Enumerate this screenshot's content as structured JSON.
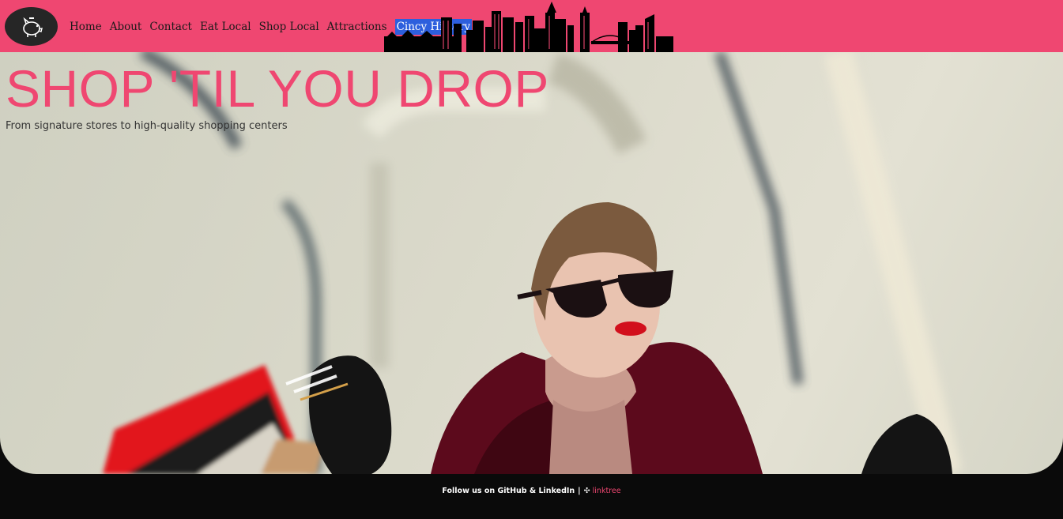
{
  "nav": {
    "logo_icon": "piggy-bank-icon",
    "items": [
      {
        "label": "Home"
      },
      {
        "label": "About"
      },
      {
        "label": "Contact"
      },
      {
        "label": "Eat Local"
      },
      {
        "label": "Shop Local"
      },
      {
        "label": "Attractions"
      },
      {
        "label": "Cincy History",
        "active": true
      }
    ],
    "bar_color": "#ef4771",
    "active_color": "#2d5fdd"
  },
  "hero": {
    "title": "SHOP 'TIL YOU DROP",
    "subtitle": "From signature stores to high-quality shopping centers",
    "title_color": "#ef4771"
  },
  "footer": {
    "text": "Follow us on GitHub & LinkedIn",
    "separator": "|",
    "link_icon": "linktree-icon",
    "link_label": "linktree",
    "link_color": "#ef4771"
  }
}
